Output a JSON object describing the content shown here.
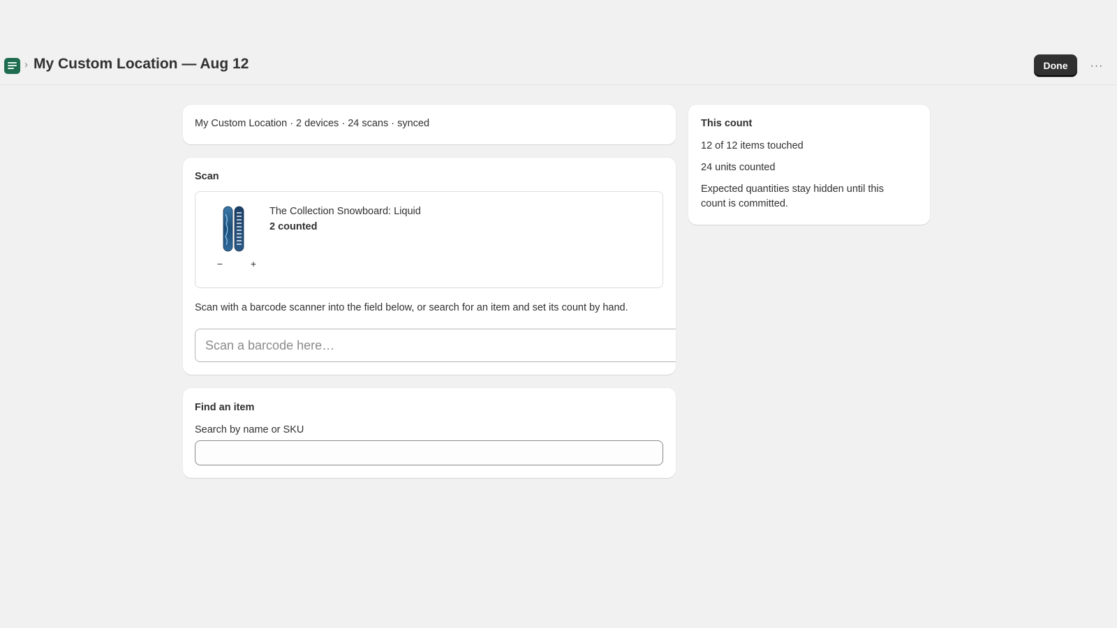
{
  "header": {
    "app_icon": "list-icon",
    "chevron": "›",
    "title": "My Custom Location — Aug 12",
    "done_label": "Done",
    "more_label": "···"
  },
  "summary": {
    "text": "My Custom Location · 2 devices · 24 scans · synced"
  },
  "scan": {
    "heading": "Scan",
    "item": {
      "name": "The Collection Snowboard: Liquid",
      "count_text": "2 counted",
      "count": 2,
      "minus_label": "−",
      "plus_label": "+",
      "thumbnail": "snowboard-image"
    },
    "help_text": "Scan with a barcode scanner into the field below, or search for an item and set its count by hand.",
    "barcode_placeholder": "Scan a barcode here…",
    "barcode_value": ""
  },
  "find": {
    "heading": "Find an item",
    "label": "Search by name or SKU",
    "value": ""
  },
  "stats": {
    "heading": "This count",
    "items_touched": "12 of 12 items touched",
    "units_counted": "24 units counted",
    "note": "Expected quantities stay hidden until this count is committed."
  },
  "colors": {
    "app_icon": "#1e6b4f",
    "primary_button": "#303030",
    "background": "#f1f1f1"
  }
}
